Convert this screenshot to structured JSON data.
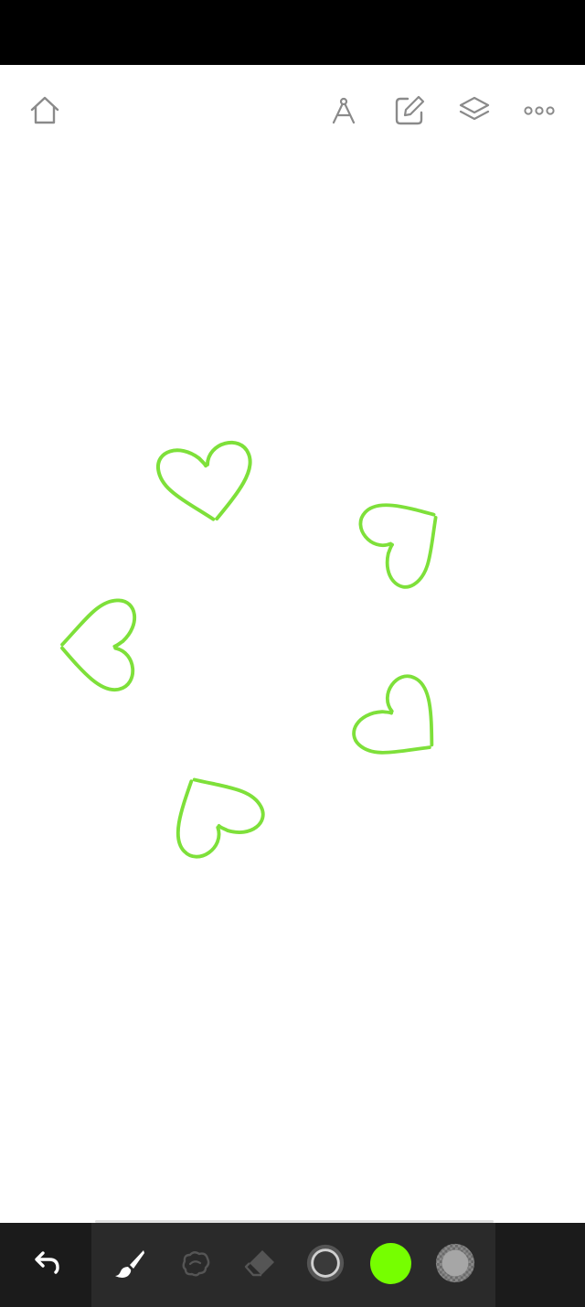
{
  "status_bar": {},
  "toolbar": {
    "home_icon": "home-icon",
    "ruler_icon": "compass-icon",
    "edit_icon": "edit-icon",
    "layers_icon": "layers-icon",
    "more_icon": "more-icon"
  },
  "canvas": {
    "stroke_color": "#7ee03a",
    "shapes": [
      "heart",
      "heart",
      "heart",
      "heart",
      "heart"
    ]
  },
  "bottom_bar": {
    "undo_icon": "undo-icon",
    "brush_icon": "brush-icon",
    "smudge_icon": "smudge-icon",
    "eraser_icon": "eraser-icon",
    "brush_size_icon": "brush-size-icon",
    "current_color": "#76ff00",
    "opacity_icon": "opacity-icon"
  },
  "colors": {
    "background": "#ffffff",
    "bar": "#1b1b1b",
    "panel": "#2a2a2a",
    "icon_inactive": "#555555",
    "icon_active": "#ffffff"
  }
}
